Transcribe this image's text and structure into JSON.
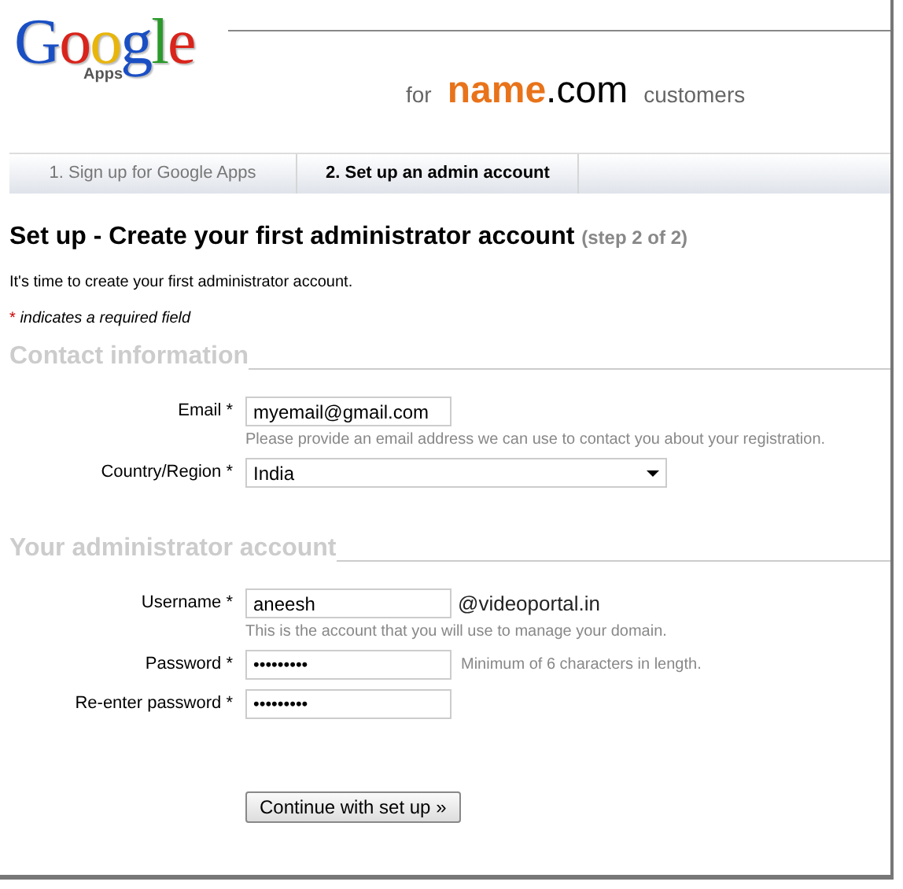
{
  "header": {
    "logo": "Google",
    "logo_sub": "Apps",
    "for": "for",
    "brand_name": "name",
    "brand_suffix": ".com",
    "customers": "customers"
  },
  "tabs": [
    {
      "label": "1. Sign up for Google Apps",
      "selected": false
    },
    {
      "label": "2. Set up an admin account",
      "selected": true
    }
  ],
  "title": "Set up - Create your first administrator account",
  "step": "(step 2 of 2)",
  "intro": "It's time to create your first administrator account.",
  "required_note": {
    "mark": "*",
    "text": "indicates a required field"
  },
  "sections": [
    {
      "heading": "Contact information",
      "fields": [
        {
          "kind": "text",
          "label": "Email *",
          "value": "myemail@gmail.com",
          "hint": "Please provide an email address we can use to contact you about your registration."
        },
        {
          "kind": "select",
          "label": "Country/Region *",
          "value": "India"
        }
      ]
    },
    {
      "heading": "Your administrator account",
      "fields": [
        {
          "kind": "text",
          "label": "Username *",
          "value": "aneesh",
          "suffix": "@videoportal.in",
          "hint": "This is the account that you will use to manage your domain."
        },
        {
          "kind": "password",
          "label": "Password *",
          "value": "•••••••••",
          "side_hint": "Minimum of 6 characters in length."
        },
        {
          "kind": "password",
          "label": "Re-enter password *",
          "value": "•••••••••"
        }
      ]
    }
  ],
  "submit": "Continue with set up »"
}
